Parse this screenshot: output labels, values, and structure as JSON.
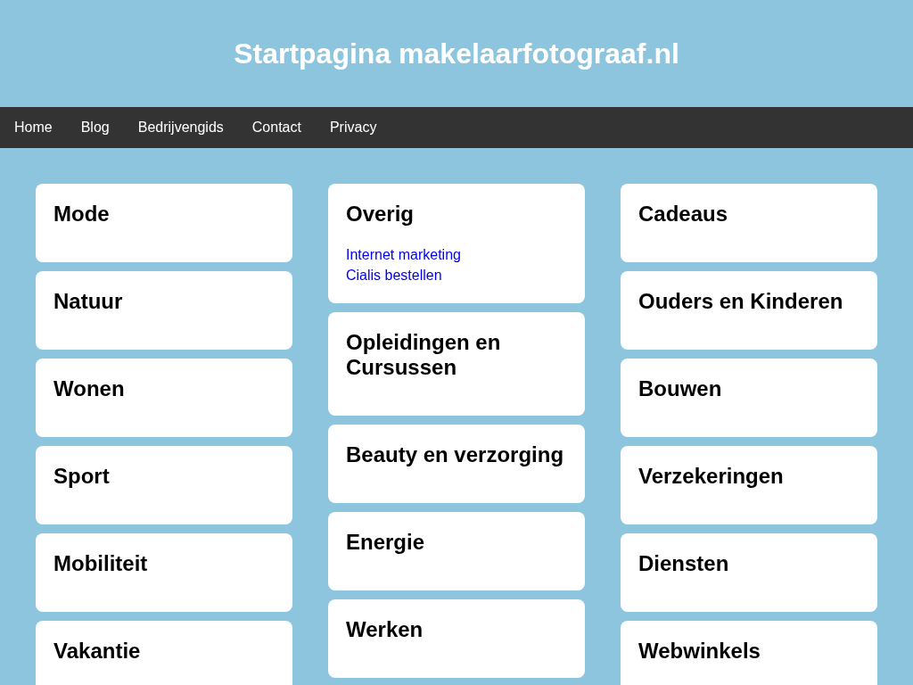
{
  "header": {
    "title": "Startpagina makelaarfotograaf.nl"
  },
  "nav": [
    "Home",
    "Blog",
    "Bedrijvengids",
    "Contact",
    "Privacy"
  ],
  "columns": [
    {
      "cards": [
        {
          "title": "Mode"
        },
        {
          "title": "Natuur"
        },
        {
          "title": "Wonen"
        },
        {
          "title": "Sport"
        },
        {
          "title": "Mobiliteit"
        },
        {
          "title": "Vakantie"
        }
      ]
    },
    {
      "cards": [
        {
          "title": "Overig",
          "links": [
            "Internet marketing",
            "Cialis bestellen"
          ]
        },
        {
          "title": "Opleidingen en Cursussen"
        },
        {
          "title": "Beauty en verzorging"
        },
        {
          "title": "Energie"
        },
        {
          "title": "Werken"
        }
      ]
    },
    {
      "cards": [
        {
          "title": "Cadeaus"
        },
        {
          "title": "Ouders en Kinderen"
        },
        {
          "title": "Bouwen"
        },
        {
          "title": "Verzekeringen"
        },
        {
          "title": "Diensten"
        },
        {
          "title": "Webwinkels"
        }
      ]
    }
  ]
}
